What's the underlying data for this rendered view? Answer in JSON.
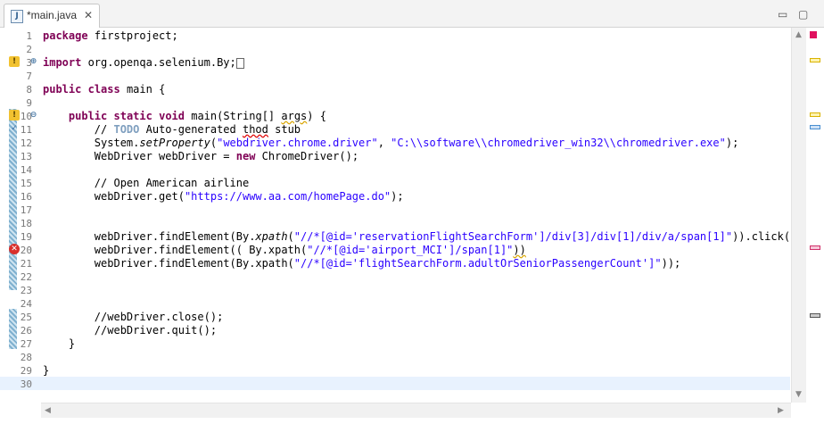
{
  "tab": {
    "icon": "java-file-icon",
    "title": "*main.java",
    "close": "✕"
  },
  "window_controls": {
    "minimize": "▭",
    "maximize": "▢"
  },
  "lines": [
    {
      "n": "1"
    },
    {
      "n": "2"
    },
    {
      "n": "3"
    },
    {
      "n": "7"
    },
    {
      "n": "8"
    },
    {
      "n": "9"
    },
    {
      "n": "10"
    },
    {
      "n": "11"
    },
    {
      "n": "12"
    },
    {
      "n": "13"
    },
    {
      "n": "14"
    },
    {
      "n": "15"
    },
    {
      "n": "16"
    },
    {
      "n": "17"
    },
    {
      "n": "18"
    },
    {
      "n": "19"
    },
    {
      "n": "20"
    },
    {
      "n": "21"
    },
    {
      "n": "22"
    },
    {
      "n": "23"
    },
    {
      "n": "24"
    },
    {
      "n": "25"
    },
    {
      "n": "26"
    },
    {
      "n": "27"
    },
    {
      "n": "28"
    },
    {
      "n": "29"
    },
    {
      "n": "30"
    }
  ],
  "code": {
    "l1_kw": "package",
    "l1_rest": " firstproject;",
    "l3_kw": "import",
    "l3_rest": " org.openqa.selenium.By;",
    "l8_kw1": "public",
    "l8_kw2": "class",
    "l8_rest": " main {",
    "l10_indent": "    ",
    "l10_kw1": "public",
    "l10_kw2": "static",
    "l10_kw3": "void",
    "l10_mid": " main(String[] ",
    "l10_args": "args",
    "l10_end": ") {",
    "l11_pre": "        // ",
    "l11_todo": "TODO",
    "l11_a": " Auto-generated ",
    "l11_thod": "thod",
    "l11_b": " stub",
    "l12_pre": "        System.",
    "l12_method": "setProperty",
    "l12_a": "(",
    "l12_s1": "\"webdriver.chrome.driver\"",
    "l12_b": ", ",
    "l12_s2": "\"C:\\\\software\\\\chromedriver_win32\\\\chromedriver.exe\"",
    "l12_c": ");",
    "l13_pre": "        WebDriver ",
    "l13_var": "webDriver",
    "l13_a": " = ",
    "l13_kw": "new",
    "l13_b": " ChromeDriver();",
    "l15": "        // Open American airline",
    "l16_pre": "        ",
    "l16_var": "webDriver",
    "l16_a": ".get(",
    "l16_s": "\"https://www.aa.com/homePage.do\"",
    "l16_b": ");",
    "l19_pre": "        ",
    "l19_var": "webDriver",
    "l19_a": ".findElement(By.",
    "l19_m": "xpath",
    "l19_b": "(",
    "l19_s": "\"//*[@id='reservationFlightSearchForm']/div[3]/div[1]/div/a/span[1]\"",
    "l19_c": ")).click();",
    "l20_pre": "        ",
    "l20_var": "webDriver",
    "l20_a": ".findElement(( By.xpath(",
    "l20_s": "\"//*[@id='airport_MCI']/span[1]\"",
    "l20_b": "))",
    "l21_pre": "        ",
    "l21_var": "webDriver",
    "l21_a": ".findElement(By.xpath(",
    "l21_s": "\"//*[@id='flightSearchForm.adultOrSeniorPassengerCount']\"",
    "l21_b": "));",
    "l25": "        //webDriver.close();",
    "l26": "        //webDriver.quit();",
    "l27": "    }",
    "l29": "}"
  },
  "colors": {
    "keyword": "#7f0055",
    "string": "#2a00ff",
    "comment": "#3f7f5f",
    "field": "#0000c0",
    "current_line": "#e8f2fe"
  }
}
